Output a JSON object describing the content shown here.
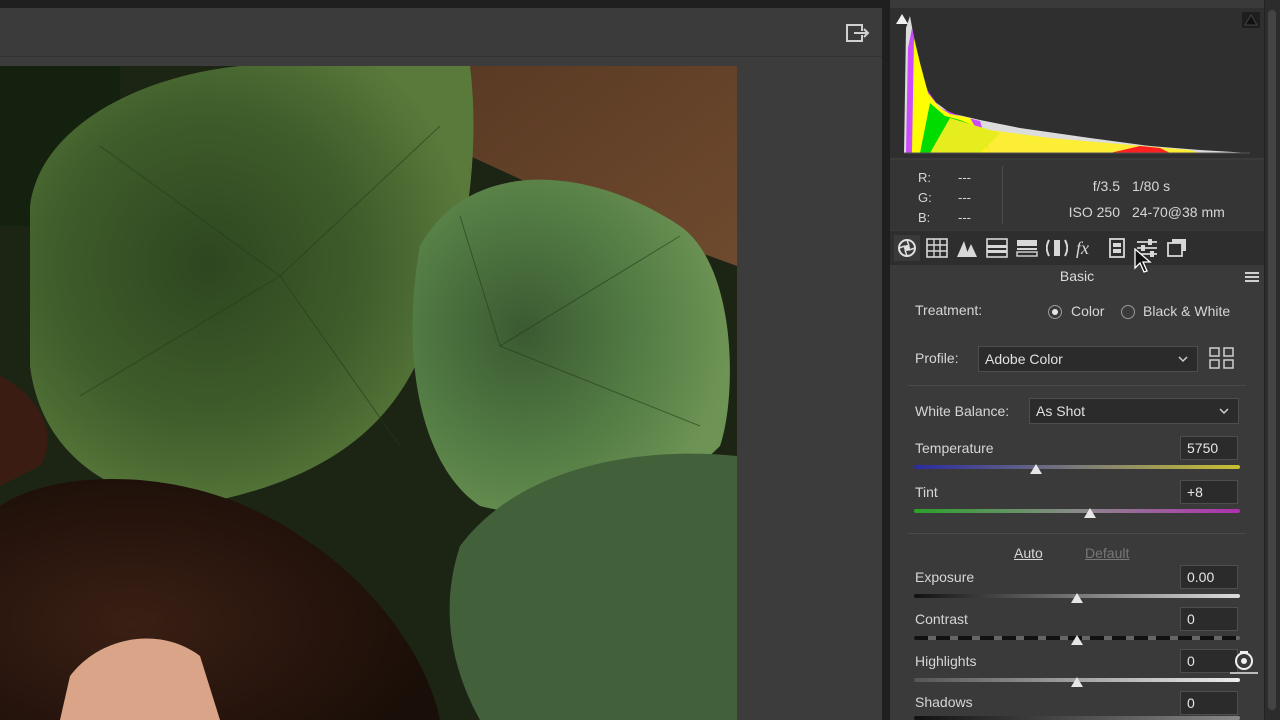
{
  "exif": {
    "aperture": "f/3.5",
    "shutter": "1/80 s",
    "iso": "ISO 250",
    "lens": "24-70@38 mm"
  },
  "readout": {
    "r_label": "R:",
    "r_value": "---",
    "g_label": "G:",
    "g_value": "---",
    "b_label": "B:",
    "b_value": "---"
  },
  "tabs": [
    {
      "icon": "basic-aperture-icon"
    },
    {
      "icon": "tone-curve-grid-icon"
    },
    {
      "icon": "detail-triangles-icon"
    },
    {
      "icon": "hsl-bars-icon"
    },
    {
      "icon": "split-toning-icon"
    },
    {
      "icon": "lens-corrections-icon"
    },
    {
      "icon": "effects-fx-icon"
    },
    {
      "icon": "calibration-film-icon"
    },
    {
      "icon": "presets-sliders-icon"
    },
    {
      "icon": "snapshots-icon"
    }
  ],
  "panel": {
    "title": "Basic",
    "treatment_label": "Treatment:",
    "color_label": "Color",
    "bw_label": "Black & White",
    "treatment_selected": "Color",
    "profile_label": "Profile:",
    "profile_value": "Adobe Color",
    "wb_label": "White Balance:",
    "wb_value": "As Shot",
    "auto_label": "Auto",
    "default_label": "Default"
  },
  "sliders": {
    "temperature": {
      "label": "Temperature",
      "value": "5750",
      "position": 0.375
    },
    "tint": {
      "label": "Tint",
      "value": "+8",
      "position": 0.54
    },
    "exposure": {
      "label": "Exposure",
      "value": "0.00",
      "position": 0.5
    },
    "contrast": {
      "label": "Contrast",
      "value": "0",
      "position": 0.5
    },
    "highlights": {
      "label": "Highlights",
      "value": "0",
      "position": 0.5
    },
    "shadows": {
      "label": "Shadows",
      "value": "0",
      "position": 0.5
    }
  },
  "colors": {
    "panel_bg": "#3a3a3a",
    "accent": "#e6e6e6"
  }
}
